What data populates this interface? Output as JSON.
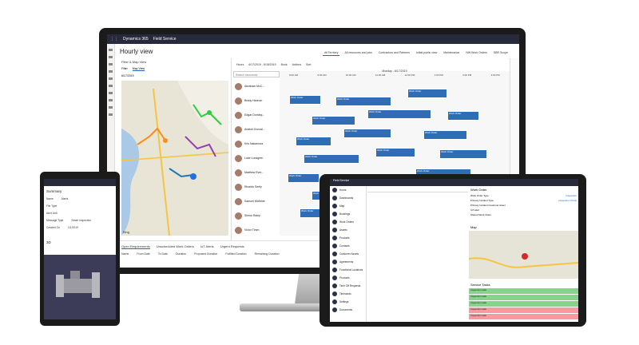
{
  "monitor": {
    "topbar": {
      "app": "Dynamics 365",
      "module": "Field Service"
    },
    "title": "Hourly view",
    "tabs": [
      "All Territory",
      "All resources and jobs",
      "Contractors and Partners",
      "Initial public view",
      "Maintenance",
      "NW Work Orders",
      "SBR Scope"
    ],
    "filter_panel": {
      "title": "Filter & Map View",
      "tabs": [
        "Filter",
        "Map View"
      ],
      "date": "6/17/2019",
      "map_credit": "Bing",
      "expand_label": "Expand"
    },
    "toolbar": {
      "hours_label": "Hours",
      "date_range": "6/17/2019 - 6/18/2019",
      "book_label": "Book",
      "actions_label": "Actions",
      "sort_label": "Sort"
    },
    "gantt": {
      "day_label": "Monday - 6/17/2019",
      "times": [
        "8:00 AM",
        "9:00 AM",
        "10:00 AM",
        "11:00 AM",
        "12:00 PM",
        "1:00 PM",
        "2:00 PM",
        "3:00 PM"
      ]
    },
    "search_placeholder": "Search resources",
    "resources": [
      {
        "name": "Abraham McC..."
      },
      {
        "name": "Brady Hannon"
      },
      {
        "name": "Edgar Dominq..."
      },
      {
        "name": "Anatoli Gonzal..."
      },
      {
        "name": "Kris Nakamura"
      },
      {
        "name": "Luke Lundgren"
      },
      {
        "name": "Matthew Ever..."
      },
      {
        "name": "Ricardo Seely"
      },
      {
        "name": "Samuel McBride"
      },
      {
        "name": "Simon Raley"
      },
      {
        "name": "Victor Timm"
      }
    ],
    "booking_label": "Work Order",
    "pagination": "1 - 11 of 13",
    "bottom_tabs": [
      "Open Requirements",
      "Unscheduled Work Orders",
      "IoT Alerts",
      "Urgent Requests"
    ],
    "bottom_columns": [
      "Name",
      "From Date",
      "To Date",
      "Duration",
      "Proposed Duration",
      "Fulfilled Duration",
      "Remaining Duration"
    ]
  },
  "phone": {
    "title": "Summary",
    "fields": [
      {
        "label": "Name",
        "value": "Alerts"
      },
      {
        "label": "File Type",
        "value": ""
      },
      {
        "label": "Alert Unit",
        "value": ""
      },
      {
        "label": "Message Type",
        "value": "Smart Inspection"
      },
      {
        "label": "Created On",
        "value": "1/1/2019"
      }
    ],
    "section_3d": "3D"
  },
  "tablet": {
    "topbar": "Field Service",
    "nav_items": [
      "Home",
      "Dashboards",
      "Map",
      "Bookings",
      "Work Orders",
      "Assets",
      "Products",
      "Contacts",
      "Customer Assets",
      "Agreements",
      "Functional Locations",
      "Products",
      "Time Off Requests",
      "Timecards",
      "Settings",
      "Documents"
    ],
    "work_order": {
      "header": "Work Order",
      "fields": [
        {
          "label": "Work Order Type",
          "value": "Inspection"
        },
        {
          "label": "Primary Incident Type",
          "value": "Inspection Check"
        },
        {
          "label": "Primary Incident Customer Asset",
          "value": ""
        },
        {
          "label": "IoT Alert",
          "value": ""
        },
        {
          "label": "Shared Work Order",
          "value": ""
        }
      ],
      "map_label": "Map",
      "tasks_label": "Service Tasks",
      "tasks": [
        "Inspection task",
        "Inspection task",
        "Inspection task",
        "Inspection task",
        "Inspection task"
      ]
    }
  }
}
